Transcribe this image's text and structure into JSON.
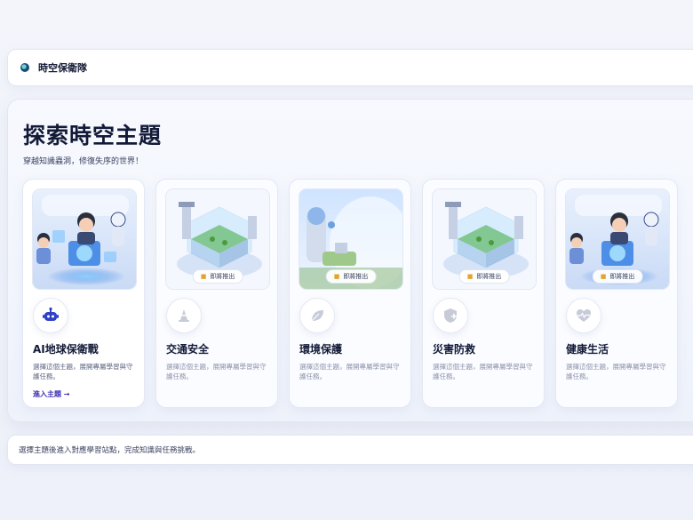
{
  "header": {
    "brand": "時空保衛隊",
    "logo_icon": "shield-globe-icon"
  },
  "main": {
    "title": "探索時空主題",
    "subtitle": "穿越知識蟲洞，修復失序的世界！",
    "themes": [
      {
        "title": "AI地球保衛戰",
        "description": "選擇這個主題，展開專屬學習與守護任務。",
        "link_label": "進入主題 →",
        "icon": "robot-icon",
        "status": "available",
        "image": "students-with-robots-illustration"
      },
      {
        "title": "交通安全",
        "description": "選擇這個主題，展開專屬學習與守護任務。",
        "badge": "即將推出",
        "icon": "traffic-cone-icon",
        "status": "coming-soon",
        "image": "futuristic-city-cube-illustration"
      },
      {
        "title": "環境保護",
        "description": "選擇這個主題，展開專屬學習與守護任務。",
        "badge": "即將推出",
        "icon": "leaf-icon",
        "status": "coming-soon",
        "image": "earth-dome-illustration"
      },
      {
        "title": "災害防救",
        "description": "選擇這個主題，展開專屬學習與守護任務。",
        "badge": "即將推出",
        "icon": "shield-plus-icon",
        "status": "coming-soon",
        "image": "futuristic-city-cube-illustration"
      },
      {
        "title": "健康生活",
        "description": "選擇這個主題，展開專屬學習與守護任務。",
        "badge": "即將推出",
        "icon": "heart-pulse-icon",
        "status": "coming-soon",
        "image": "students-with-robots-illustration"
      }
    ]
  },
  "footer": {
    "text": "選擇主題後進入對應學習站點，完成知識與任務挑戰。"
  },
  "colors": {
    "accent": "#3b2fb5",
    "icon_blue": "#2f3fc6",
    "icon_gray": "#c7cbd8",
    "badge_lock": "#e5a32d"
  }
}
